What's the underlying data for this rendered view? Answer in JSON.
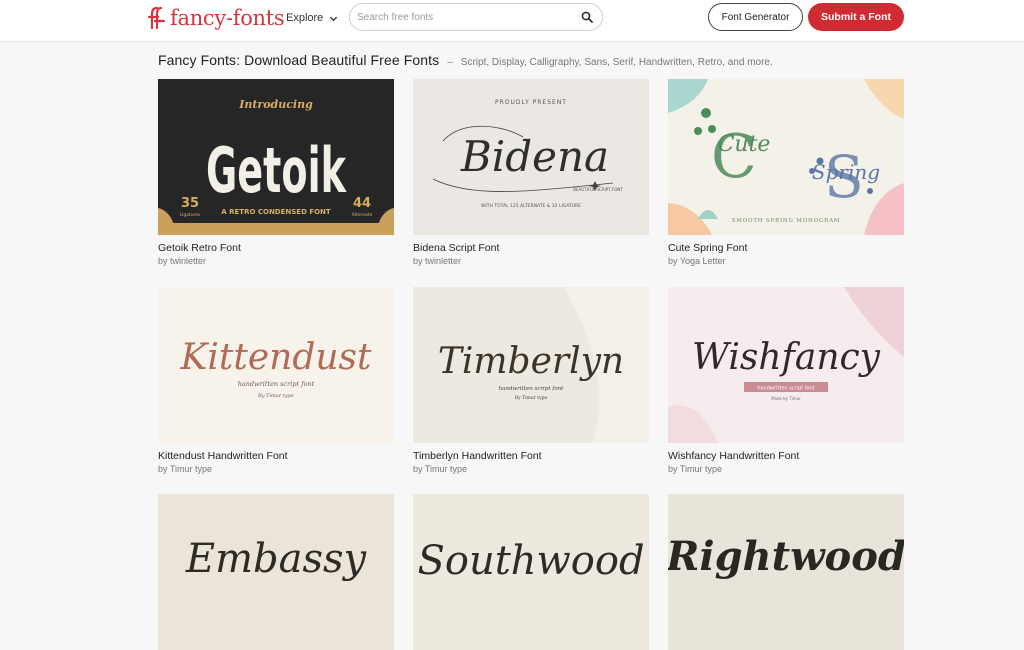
{
  "header": {
    "logo_text": "fancy-fonts",
    "explore_label": "Explore",
    "search_placeholder": "Search free fonts",
    "font_generator_label": "Font Generator",
    "submit_label": "Submit a Font",
    "brand_color": "#d02b33"
  },
  "page": {
    "title": "Fancy Fonts: Download Beautiful Free Fonts",
    "separator": "–",
    "subtitle": "Script, Display, Calligraphy, Sans, Serif, Handwritten, Retro, and more."
  },
  "fonts": [
    {
      "title": "Getoik Retro Font",
      "author": "by twinletter",
      "preview": {
        "wordmark": "Getoik",
        "top_text": "Introducing",
        "tagline": "A RETRO CONDENSED FONT",
        "left_badge_number": "35",
        "left_badge_text": "Ligatures",
        "right_badge_number": "44",
        "right_badge_text": "Alternate"
      }
    },
    {
      "title": "Bidena Script Font",
      "author": "by twinletter",
      "preview": {
        "wordmark": "Bidena",
        "top_text": "PROUDLY PRESENT",
        "side_text": "BEAUTIFUL SCRIPT FONT",
        "tagline": "WITH TOTAL 125 ALTERNATE & 32 LIGATURE"
      }
    },
    {
      "title": "Cute Spring Font",
      "author": "by Yoga Letter",
      "preview": {
        "wordmark_a": "Cute",
        "wordmark_b": "Spring",
        "tagline": "SMOOTH SPRING MONOGRAM"
      }
    },
    {
      "title": "Kittendust Handwritten Font",
      "author": "by Timur type",
      "preview": {
        "wordmark": "Kittendust",
        "tagline": "handwritten script font",
        "byline": "By Timur type"
      }
    },
    {
      "title": "Timberlyn Handwritten Font",
      "author": "by Timur type",
      "preview": {
        "wordmark": "Timberlyn",
        "tagline": "handwritten script font",
        "byline": "By Timur type"
      }
    },
    {
      "title": "Wishfancy Handwritten Font",
      "author": "by Timur type",
      "preview": {
        "wordmark": "Wishfancy",
        "tagline": "handwritten script font",
        "byline": "Made by Timur"
      }
    },
    {
      "title": "",
      "author": "",
      "preview": {
        "wordmark": "Embassy"
      }
    },
    {
      "title": "",
      "author": "",
      "preview": {
        "wordmark": "Southwood"
      }
    },
    {
      "title": "",
      "author": "",
      "preview": {
        "wordmark": "Rightwood"
      }
    }
  ]
}
